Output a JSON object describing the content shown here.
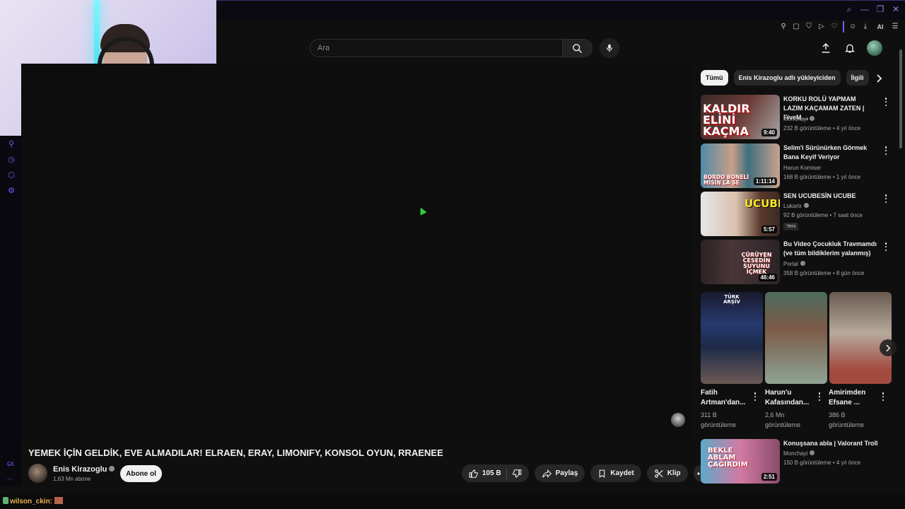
{
  "search": {
    "placeholder": "Ara"
  },
  "video": {
    "title": "YEMEK İÇİN GELDİK, EVE ALMADILAR! ELRAEN, ERAY, LIMONIFY, KONSOL OYUN, RRAENEE",
    "channel": "Enis Kirazoglu",
    "subscribers": "1,63 Mn abone",
    "subscribe_label": "Abone ol",
    "likes": "105 B",
    "share_label": "Paylaş",
    "save_label": "Kaydet",
    "clip_label": "Klip"
  },
  "chips": [
    "Tümü",
    "Enis Kirazoglu adlı yükleyiciden",
    "İlgili"
  ],
  "recommendations": [
    {
      "title": "KORKU ROLÜ YAPMAM LAZIM KAÇAMAM ZATEN | FiveM ...",
      "channel": "Monchayi",
      "meta": "232 B görüntüleme • 4 yıl önce",
      "duration": "9:40",
      "thumb_text": "KALDIR ELİNİ KAÇMA"
    },
    {
      "title": "Selim'i Sürünürken Görmek Bana Keyif Veriyor",
      "channel": "Harun Komiser",
      "meta": "168 B görüntüleme • 1 yıl önce",
      "duration": "1:11:14",
      "thumb_text": "BORDO BONELİ MİSİN LA SE"
    },
    {
      "title": "SEN UCUBESİN UCUBE",
      "channel": "Lukarix",
      "meta": "92 B görüntüleme • 7 saat önce",
      "badge": "Yeni",
      "duration": "5:57",
      "thumb_text": "UCUBE"
    },
    {
      "title": "Bu Video Çocukluk Travmamdı (ve tüm bildiklerim yalanmış)",
      "channel": "Portal",
      "meta": "358 B görüntüleme • 8 gün önce",
      "duration": "46:46",
      "thumb_text": "ÇÜRÜYEN CESEDİN SUYUNU İÇMEK"
    }
  ],
  "shorts": [
    {
      "title": "Fatih Artman'dan...",
      "views": "311 B görüntüleme",
      "thumb_text": "TÜRK ARŞİV"
    },
    {
      "title": "Harun'u Kafasından...",
      "views": "2,6 Mn görüntüleme"
    },
    {
      "title": "Amirimden Efsane ...",
      "views": "386 B görüntüleme"
    }
  ],
  "last_rec": {
    "title": "Konuşsana abla  | Valorant Troll",
    "channel": "Monchayi",
    "meta": "150 B görüntüleme • 4 yıl önce",
    "duration": "2:51",
    "thumb_text": "BEKLE ABLAM ÇAĞIRDIM"
  },
  "chat": {
    "user": "wilson_ckin:"
  },
  "rail": {
    "gx": "GX",
    "dots": "..."
  },
  "ext_ai": "AI"
}
